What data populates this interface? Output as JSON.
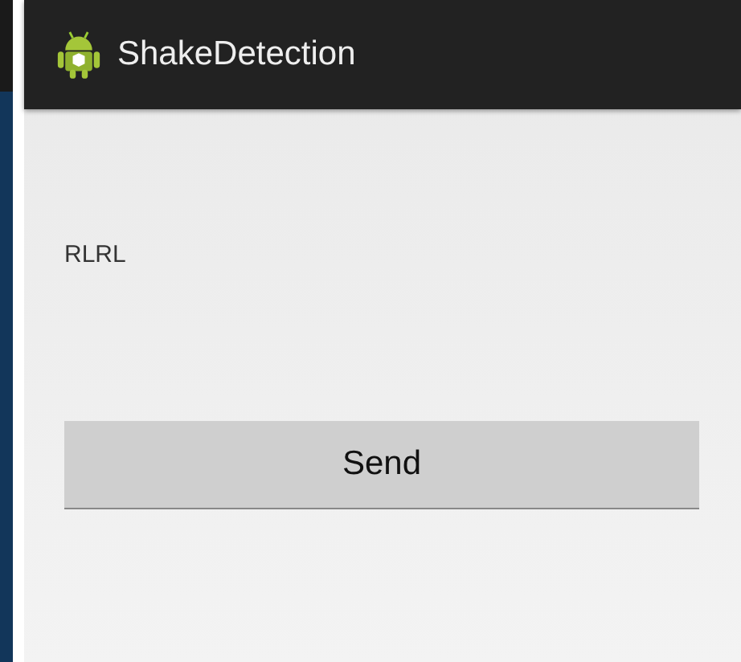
{
  "action_bar": {
    "title": "ShakeDetection"
  },
  "content": {
    "text": "RLRL",
    "button": "Send"
  }
}
